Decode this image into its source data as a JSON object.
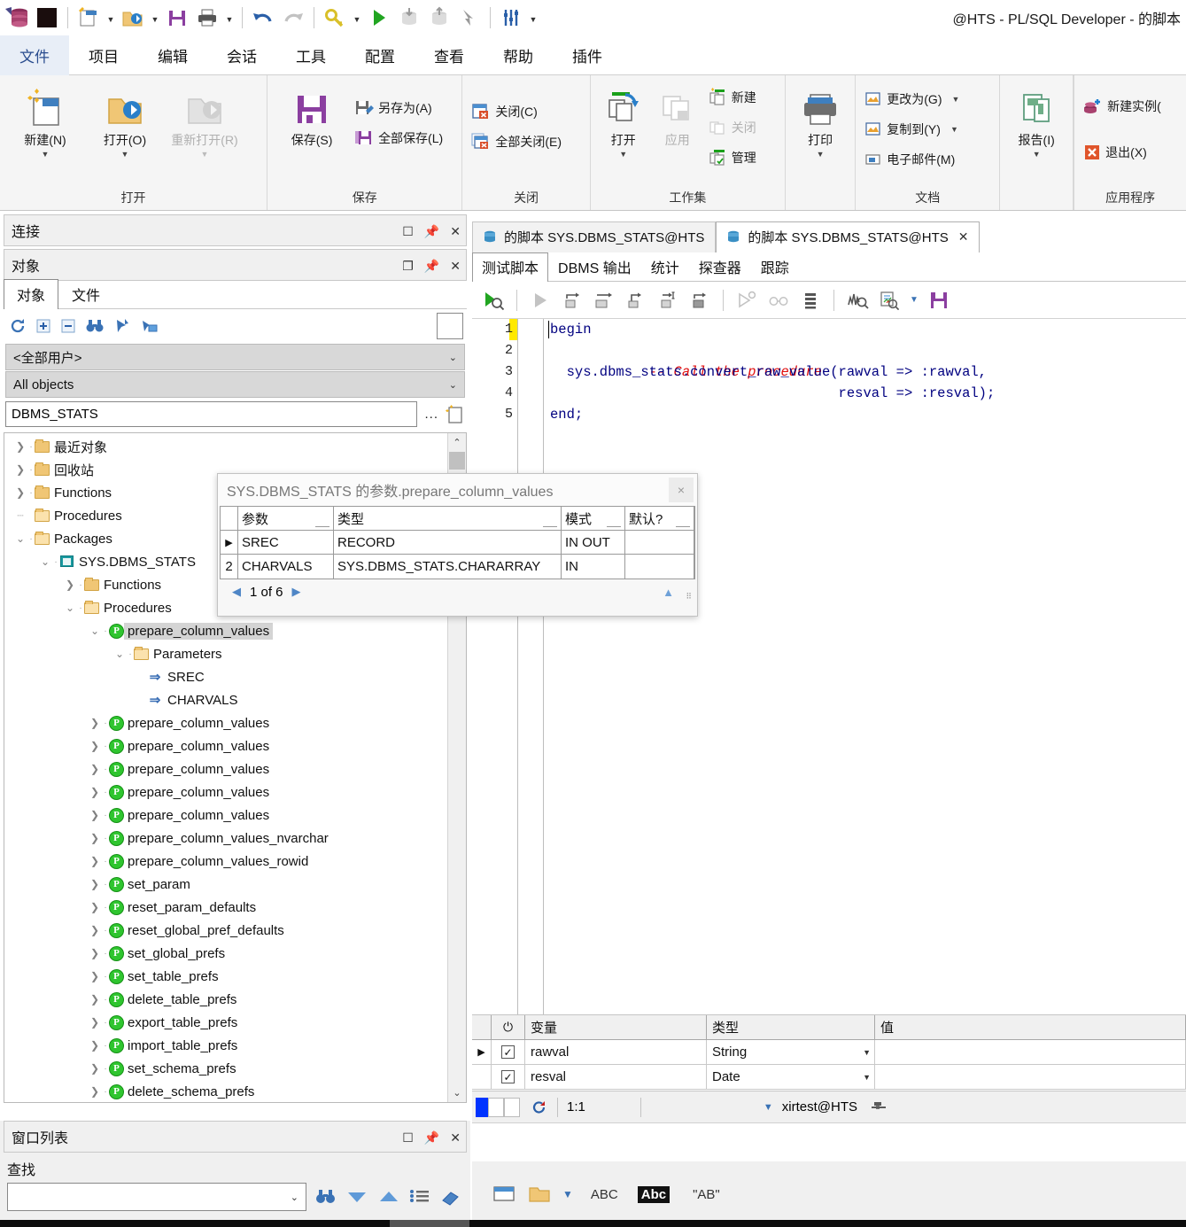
{
  "window": {
    "title": "@HTS - PL/SQL Developer - 的脚本"
  },
  "quick_access": {
    "items": [
      {
        "name": "app-logo-icon",
        "label": "PL/SQL Developer"
      },
      {
        "name": "black-square-icon",
        "label": ""
      },
      {
        "name": "new-icon",
        "label": "新建"
      },
      {
        "name": "open-icon",
        "label": "打开"
      },
      {
        "name": "save-icon",
        "label": "保存"
      },
      {
        "name": "print-icon",
        "label": "打印"
      },
      {
        "name": "undo-icon",
        "label": "撤销"
      },
      {
        "name": "redo-icon",
        "label": "重做"
      },
      {
        "name": "key-icon",
        "label": "登录"
      },
      {
        "name": "execute-icon",
        "label": "执行"
      },
      {
        "name": "commit-icon",
        "label": "提交"
      },
      {
        "name": "rollback-icon",
        "label": "回滚"
      },
      {
        "name": "break-icon",
        "label": "中断"
      },
      {
        "name": "sliders-icon",
        "label": "会话"
      },
      {
        "name": "customize-icon",
        "label": "自定义"
      }
    ]
  },
  "menu": {
    "tabs": [
      {
        "label": "文件",
        "active": true
      },
      {
        "label": "项目",
        "active": false
      },
      {
        "label": "编辑",
        "active": false
      },
      {
        "label": "会话",
        "active": false
      },
      {
        "label": "工具",
        "active": false
      },
      {
        "label": "配置",
        "active": false
      },
      {
        "label": "查看",
        "active": false
      },
      {
        "label": "帮助",
        "active": false
      },
      {
        "label": "插件",
        "active": false
      }
    ]
  },
  "ribbon": {
    "groups": [
      {
        "name": "open",
        "label": "打开",
        "big": [
          {
            "label": "新建(N)",
            "accel": "N",
            "icon": "new-doc-icon",
            "caret": true,
            "disabled": false
          },
          {
            "label": "打开(O)",
            "accel": "O",
            "icon": "open-folder-icon",
            "caret": true,
            "disabled": false
          },
          {
            "label": "重新打开(R)",
            "accel": "R",
            "icon": "reopen-folder-icon",
            "caret": true,
            "disabled": true
          }
        ],
        "small": []
      },
      {
        "name": "save",
        "label": "保存",
        "big": [
          {
            "label": "保存(S)",
            "accel": "S",
            "icon": "save-disk-icon",
            "caret": false,
            "disabled": false
          }
        ],
        "small": [
          {
            "label": "另存为(A)",
            "icon": "save-as-icon",
            "disabled": false
          },
          {
            "label": "全部保存(L)",
            "icon": "save-all-icon",
            "disabled": false
          }
        ]
      },
      {
        "name": "close",
        "label": "关闭",
        "big": [],
        "small": [
          {
            "label": "关闭(C)",
            "icon": "close-doc-icon",
            "disabled": false
          },
          {
            "label": "全部关闭(E)",
            "icon": "close-all-icon",
            "disabled": false
          }
        ]
      },
      {
        "name": "workset",
        "label": "工作集",
        "big": [
          {
            "label": "打开",
            "icon": "workset-open-icon",
            "caret": true,
            "disabled": false
          },
          {
            "label": "应用",
            "icon": "workset-apply-icon",
            "caret": false,
            "disabled": true
          }
        ],
        "small": [
          {
            "label": "新建",
            "icon": "workset-new-icon",
            "disabled": false
          },
          {
            "label": "关闭",
            "icon": "workset-close-icon",
            "disabled": true
          },
          {
            "label": "管理",
            "icon": "workset-manage-icon",
            "disabled": false
          }
        ]
      },
      {
        "name": "print",
        "label": "",
        "big": [
          {
            "label": "打印",
            "icon": "printer-icon",
            "caret": true,
            "disabled": false
          }
        ],
        "small": []
      },
      {
        "name": "document",
        "label": "文档",
        "big": [],
        "small": [
          {
            "label": "更改为(G)",
            "icon": "change-to-icon",
            "caret": true,
            "disabled": false
          },
          {
            "label": "复制到(Y)",
            "icon": "copy-to-icon",
            "caret": true,
            "disabled": false
          },
          {
            "label": "电子邮件(M)",
            "icon": "email-icon",
            "caret": false,
            "disabled": false
          }
        ]
      },
      {
        "name": "report",
        "label": "",
        "big": [
          {
            "label": "报告(I)",
            "icon": "report-icon",
            "caret": true,
            "disabled": false
          }
        ],
        "small": []
      },
      {
        "name": "application",
        "label": "应用程序",
        "big": [],
        "small": [
          {
            "label": "新建实例(",
            "icon": "new-instance-icon",
            "disabled": false
          },
          {
            "label": "退出(X)",
            "icon": "exit-icon",
            "disabled": false
          }
        ]
      }
    ]
  },
  "left_dock": {
    "connections_panel": {
      "title": "连接",
      "buttons": [
        "maximize-icon",
        "pin-icon",
        "close-icon"
      ]
    },
    "objects_panel": {
      "title": "对象",
      "buttons": [
        "restore-icon",
        "pin-icon",
        "close-icon"
      ],
      "tabs": [
        {
          "label": "对象",
          "active": true
        },
        {
          "label": "文件",
          "active": false
        }
      ],
      "toolbar": [
        {
          "name": "refresh-icon"
        },
        {
          "name": "expand-all-icon"
        },
        {
          "name": "collapse-all-icon"
        },
        {
          "name": "find-binoculars-icon"
        },
        {
          "name": "filter-icon"
        },
        {
          "name": "folder-filter-icon"
        }
      ],
      "user_filter": "<全部用户>",
      "object_filter": "All objects",
      "search_value": "DBMS_STATS",
      "search_browse_label": "...",
      "new_filter_icon": "new-filter-icon"
    },
    "tree": [
      {
        "label": "最近对象",
        "icon": "folder",
        "indent": 0,
        "state": "collapsed"
      },
      {
        "label": "回收站",
        "icon": "folder",
        "indent": 0,
        "state": "collapsed"
      },
      {
        "label": "Functions",
        "icon": "folder",
        "indent": 0,
        "state": "collapsed"
      },
      {
        "label": "Procedures",
        "icon": "folder-open",
        "indent": 0,
        "state": "leaf"
      },
      {
        "label": "Packages",
        "icon": "folder-open",
        "indent": 0,
        "state": "expanded"
      },
      {
        "label": "SYS.DBMS_STATS",
        "icon": "package",
        "indent": 1,
        "state": "expanded"
      },
      {
        "label": "Functions",
        "icon": "folder",
        "indent": 2,
        "state": "collapsed"
      },
      {
        "label": "Procedures",
        "icon": "folder-open",
        "indent": 2,
        "state": "expanded"
      },
      {
        "label": "prepare_column_values",
        "icon": "proc",
        "indent": 3,
        "state": "expanded",
        "selected": true
      },
      {
        "label": "Parameters",
        "icon": "folder-open",
        "indent": 4,
        "state": "expanded"
      },
      {
        "label": "SREC",
        "icon": "param",
        "indent": 5,
        "state": "leaf"
      },
      {
        "label": "CHARVALS",
        "icon": "param",
        "indent": 5,
        "state": "leaf"
      },
      {
        "label": "prepare_column_values",
        "icon": "proc",
        "indent": 3,
        "state": "collapsed"
      },
      {
        "label": "prepare_column_values",
        "icon": "proc",
        "indent": 3,
        "state": "collapsed"
      },
      {
        "label": "prepare_column_values",
        "icon": "proc",
        "indent": 3,
        "state": "collapsed"
      },
      {
        "label": "prepare_column_values",
        "icon": "proc",
        "indent": 3,
        "state": "collapsed"
      },
      {
        "label": "prepare_column_values",
        "icon": "proc",
        "indent": 3,
        "state": "collapsed"
      },
      {
        "label": "prepare_column_values_nvarchar",
        "icon": "proc",
        "indent": 3,
        "state": "collapsed"
      },
      {
        "label": "prepare_column_values_rowid",
        "icon": "proc",
        "indent": 3,
        "state": "collapsed"
      },
      {
        "label": "set_param",
        "icon": "proc",
        "indent": 3,
        "state": "collapsed"
      },
      {
        "label": "reset_param_defaults",
        "icon": "proc",
        "indent": 3,
        "state": "collapsed"
      },
      {
        "label": "reset_global_pref_defaults",
        "icon": "proc",
        "indent": 3,
        "state": "collapsed"
      },
      {
        "label": "set_global_prefs",
        "icon": "proc",
        "indent": 3,
        "state": "collapsed"
      },
      {
        "label": "set_table_prefs",
        "icon": "proc",
        "indent": 3,
        "state": "collapsed"
      },
      {
        "label": "delete_table_prefs",
        "icon": "proc",
        "indent": 3,
        "state": "collapsed"
      },
      {
        "label": "export_table_prefs",
        "icon": "proc",
        "indent": 3,
        "state": "collapsed"
      },
      {
        "label": "import_table_prefs",
        "icon": "proc",
        "indent": 3,
        "state": "collapsed"
      },
      {
        "label": "set_schema_prefs",
        "icon": "proc",
        "indent": 3,
        "state": "collapsed"
      },
      {
        "label": "delete_schema_prefs",
        "icon": "proc",
        "indent": 3,
        "state": "collapsed"
      }
    ],
    "window_list": {
      "title": "窗口列表",
      "buttons": [
        "maximize-icon",
        "pin-icon",
        "close-icon"
      ]
    },
    "find_panel": {
      "label": "查找",
      "input_value": "",
      "buttons": [
        {
          "name": "find-binoculars-icon"
        },
        {
          "name": "find-next-down-icon"
        },
        {
          "name": "find-prev-up-icon"
        },
        {
          "name": "find-list-icon"
        },
        {
          "name": "clear-eraser-icon"
        }
      ]
    }
  },
  "editor": {
    "doc_tabs": [
      {
        "label": "的脚本 SYS.DBMS_STATS@HTS",
        "active": false,
        "closable": false
      },
      {
        "label": "的脚本 SYS.DBMS_STATS@HTS",
        "active": true,
        "closable": true
      }
    ],
    "sub_tabs": [
      {
        "label": "测试脚本",
        "active": true
      },
      {
        "label": "DBMS 输出",
        "active": false
      },
      {
        "label": "统计",
        "active": false
      },
      {
        "label": "探查器",
        "active": false
      },
      {
        "label": "跟踪",
        "active": false
      }
    ],
    "toolbar": [
      {
        "name": "run-debug-icon",
        "disabled": false
      },
      {
        "name": "run-icon",
        "disabled": true
      },
      {
        "name": "step-over-icon",
        "disabled": false
      },
      {
        "name": "step-into-icon",
        "disabled": false
      },
      {
        "name": "step-out-icon",
        "disabled": false
      },
      {
        "name": "run-to-cursor-icon",
        "disabled": false
      },
      {
        "name": "run-to-exception-icon",
        "disabled": false
      },
      {
        "name": "breakpoint-config-icon",
        "disabled": true
      },
      {
        "name": "watches-icon",
        "disabled": true
      },
      {
        "name": "call-stack-icon",
        "disabled": false
      },
      {
        "name": "explain-plan-icon",
        "disabled": false
      },
      {
        "name": "beautifier-icon",
        "disabled": false
      },
      {
        "name": "beautifier-dropdown-icon",
        "disabled": false
      },
      {
        "name": "save-icon",
        "disabled": false
      }
    ],
    "code_lines": [
      {
        "num": "1",
        "current": true,
        "tokens": [
          {
            "t": "begin",
            "c": "plain"
          }
        ]
      },
      {
        "num": "2",
        "current": false,
        "tokens": [
          {
            "t": "  ",
            "c": "plain"
          },
          {
            "t": "-- Call the procedure",
            "c": "cmt"
          }
        ]
      },
      {
        "num": "3",
        "current": false,
        "tokens": [
          {
            "t": "  sys.dbms_stats.convert_raw_value(rawval => :rawval,",
            "c": "plain"
          }
        ]
      },
      {
        "num": "4",
        "current": false,
        "tokens": [
          {
            "t": "                                   resval => :resval);",
            "c": "plain"
          }
        ]
      },
      {
        "num": "5",
        "current": false,
        "tokens": [
          {
            "t": "end;",
            "c": "plain"
          }
        ]
      }
    ],
    "variables_grid": {
      "columns": [
        "",
        "",
        "变量",
        "类型",
        "值"
      ],
      "rows": [
        {
          "selected": true,
          "checked": true,
          "variable": "rawval",
          "type": "String",
          "value": ""
        },
        {
          "selected": false,
          "checked": true,
          "variable": "resval",
          "type": "Date",
          "value": ""
        }
      ]
    },
    "status_bar": {
      "position": "1:1",
      "connection": "xirtest@HTS",
      "pin_icon": "pin-icon",
      "refresh_icon": "refresh-icon",
      "dropdown_icon": "chevron-down-icon"
    }
  },
  "popup": {
    "title": "SYS.DBMS_STATS 的参数.prepare_column_values",
    "close_label": "×",
    "columns": [
      "",
      "参数",
      "类型",
      "模式",
      "默认?"
    ],
    "rows": [
      {
        "marker": "▶",
        "num": "",
        "param": "SREC",
        "type": "RECORD",
        "mode": "IN OUT",
        "default": ""
      },
      {
        "marker": "",
        "num": "2",
        "param": "CHARVALS",
        "type": "SYS.DBMS_STATS.CHARARRAY",
        "mode": "IN",
        "default": ""
      }
    ],
    "nav": {
      "prev_icon": "nav-prev-icon",
      "next_icon": "nav-next-icon",
      "position": "1 of 6",
      "collapse_icon": "collapse-up-icon"
    }
  },
  "bottom_toolbar": {
    "items": [
      {
        "name": "window-icon",
        "label": ""
      },
      {
        "name": "folder-icon",
        "label": ""
      },
      {
        "name": "dropdown-icon",
        "label": ""
      },
      {
        "name": "abc-icon",
        "label": "ABC"
      },
      {
        "name": "match-case-icon",
        "label": "Abc"
      },
      {
        "name": "quoted-ab-icon",
        "label": "\"AB\""
      }
    ]
  },
  "colors": {
    "accent_blue": "#4472a8",
    "purple_save": "#8b3fa0",
    "green_run": "#21a521",
    "red_comment": "#e01010",
    "navy_code": "#000080",
    "ribbon_bg": "#f5f5f5",
    "tab_active": "#e8eef7"
  }
}
